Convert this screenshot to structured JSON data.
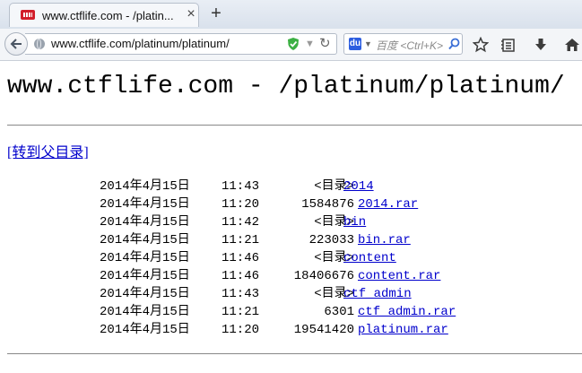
{
  "browser": {
    "tab": {
      "title": "www.ctflife.com - /platin..."
    },
    "address_bar": {
      "url": "www.ctflife.com/platinum/platinum/"
    },
    "search_bar": {
      "placeholder": "百度 <Ctrl+K>"
    }
  },
  "page": {
    "title": "www.ctflife.com - /platinum/platinum/",
    "parent_link": "[转到父目录]",
    "entries": [
      {
        "date": "2014年4月15日",
        "time": "11:43",
        "size": "<目录>",
        "name": "2014",
        "is_dir": true
      },
      {
        "date": "2014年4月15日",
        "time": "11:20",
        "size": "1584876",
        "name": "2014.rar",
        "is_dir": false
      },
      {
        "date": "2014年4月15日",
        "time": "11:42",
        "size": "<目录>",
        "name": "bin",
        "is_dir": true
      },
      {
        "date": "2014年4月15日",
        "time": "11:21",
        "size": "223033",
        "name": "bin.rar",
        "is_dir": false
      },
      {
        "date": "2014年4月15日",
        "time": "11:46",
        "size": "<目录>",
        "name": "content",
        "is_dir": true
      },
      {
        "date": "2014年4月15日",
        "time": "11:46",
        "size": "18406676",
        "name": "content.rar",
        "is_dir": false
      },
      {
        "date": "2014年4月15日",
        "time": "11:43",
        "size": "<目录>",
        "name": "ctf_admin",
        "is_dir": true
      },
      {
        "date": "2014年4月15日",
        "time": "11:21",
        "size": "6301",
        "name": "ctf_admin.rar",
        "is_dir": false
      },
      {
        "date": "2014年4月15日",
        "time": "11:20",
        "size": "19541420",
        "name": "platinum.rar",
        "is_dir": false
      }
    ]
  },
  "colors": {
    "link": "#0000cc",
    "shield": "#3cb043"
  },
  "icons": [
    "favicon",
    "close-icon",
    "new-tab-icon",
    "back-arrow-icon",
    "globe-icon",
    "shield-icon",
    "chevron-down-icon",
    "reload-icon",
    "baidu-icon",
    "search-icon",
    "star-icon",
    "reader-icon",
    "download-icon",
    "home-icon"
  ]
}
